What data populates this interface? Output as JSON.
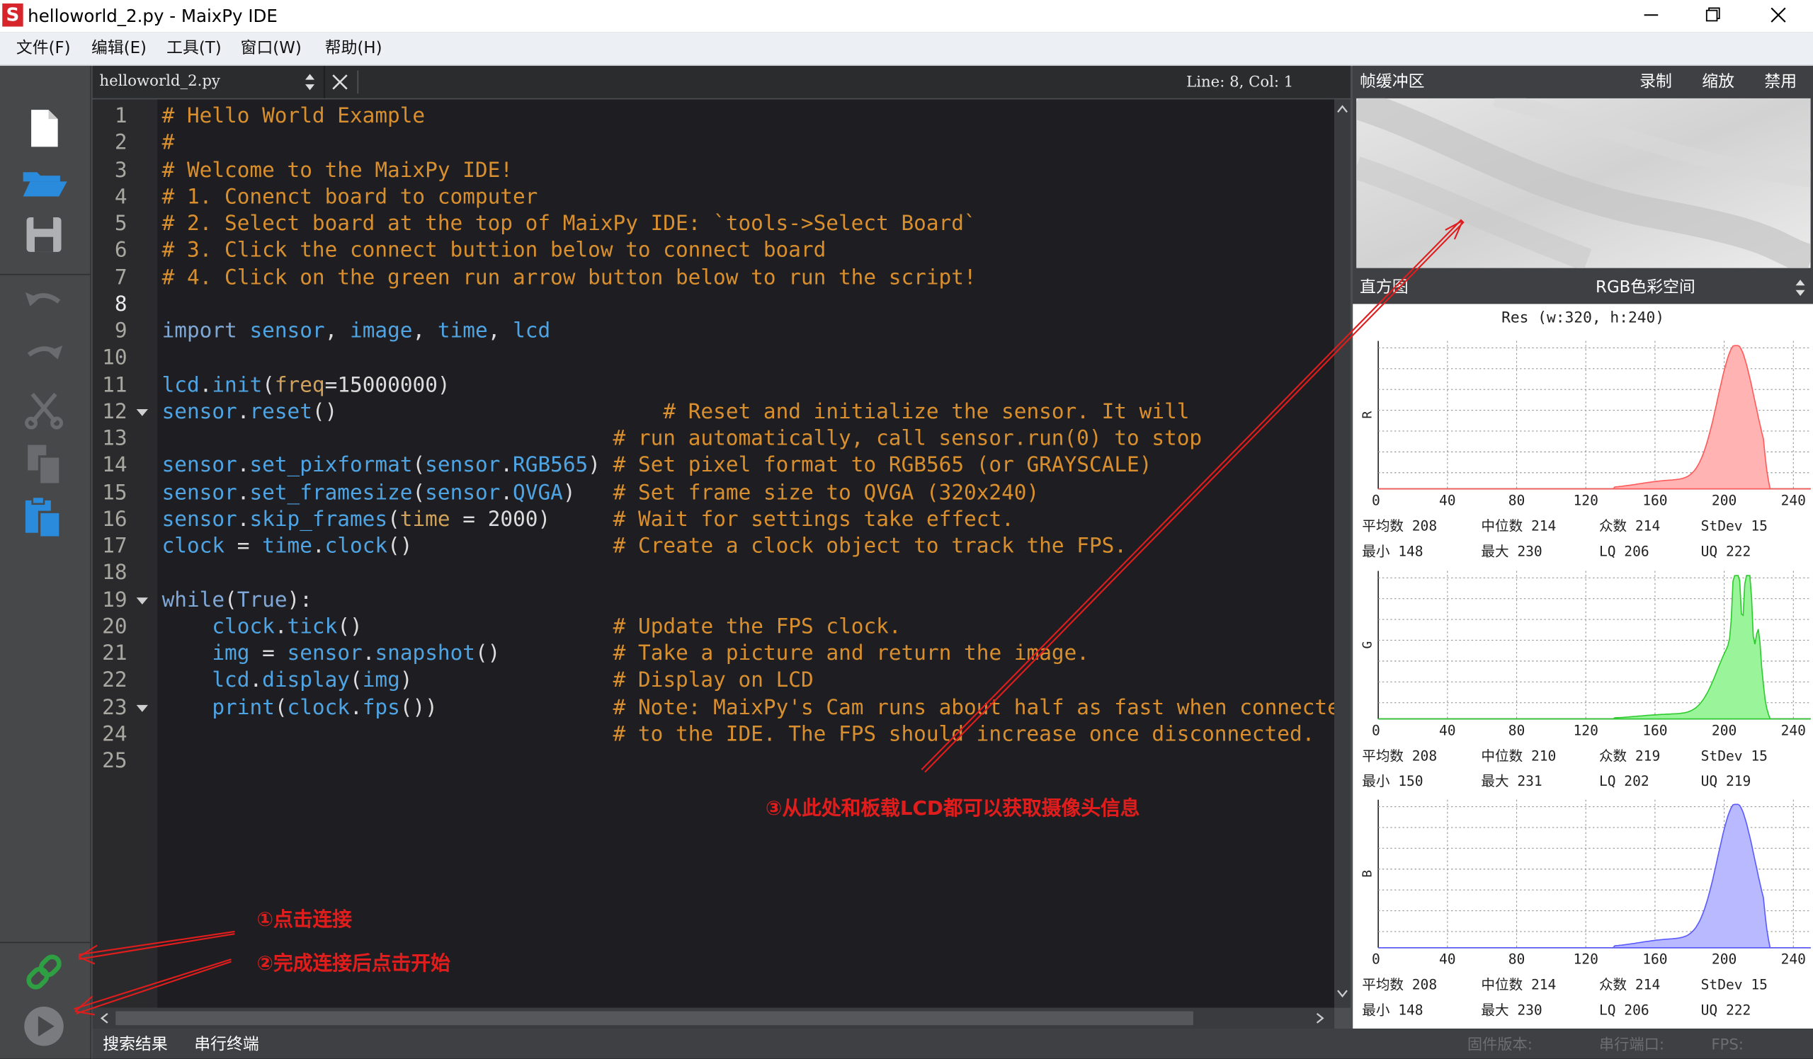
{
  "window": {
    "app_icon_letter": "S",
    "title": "helloworld_2.py - MaixPy IDE"
  },
  "menu": [
    "文件(F)",
    "编辑(E)",
    "工具(T)",
    "窗口(W)",
    "帮助(H)"
  ],
  "editor": {
    "tab_filename": "helloworld_2.py",
    "cursor_position": "Line: 8, Col: 1",
    "current_line": 8,
    "fold_lines": [
      12,
      19,
      23
    ]
  },
  "framebuffer": {
    "label": "帧缓冲区",
    "record": "录制",
    "zoom": "缩放",
    "disable": "禁用"
  },
  "histogram": {
    "label": "直方图",
    "colorspace": "RGB色彩空间",
    "resolution": "Res (w:320, h:240)",
    "ticks": [
      "0",
      "40",
      "80",
      "120",
      "160",
      "200",
      "240"
    ],
    "channels": [
      {
        "name": "R",
        "fill": "#ffb3b3",
        "stroke": "#ff5b5b",
        "mean": "208",
        "median": "214",
        "mode": "214",
        "stdev": "15",
        "min": "148",
        "max": "230",
        "lq": "206",
        "uq": "222"
      },
      {
        "name": "G",
        "fill": "#9af59a",
        "stroke": "#2ecb2e",
        "mean": "208",
        "median": "210",
        "mode": "219",
        "stdev": "15",
        "min": "150",
        "max": "231",
        "lq": "202",
        "uq": "219"
      },
      {
        "name": "B",
        "fill": "#b9b9ff",
        "stroke": "#5b5bff",
        "mean": "208",
        "median": "214",
        "mode": "214",
        "stdev": "15",
        "min": "148",
        "max": "230",
        "lq": "206",
        "uq": "222"
      }
    ],
    "stat_labels": {
      "mean": "平均数",
      "median": "中位数",
      "mode": "众数",
      "stdev": "StDev",
      "min": "最小",
      "max": "最大",
      "lq": "LQ",
      "uq": "UQ"
    }
  },
  "annotations": {
    "connect": "①点击连接",
    "start": "②完成连接后点击开始",
    "info": "③从此处和板载LCD都可以获取摄像头信息"
  },
  "bottom_tabs": [
    "搜索结果",
    "串行终端"
  ],
  "status": {
    "firmware": "固件版本:",
    "serial_port": "串行端口:",
    "fps": "FPS:"
  },
  "colors": {
    "accent_blue": "#2a8bdc",
    "connect_green": "#2ea043",
    "annotation_red": "#e01d1d"
  }
}
